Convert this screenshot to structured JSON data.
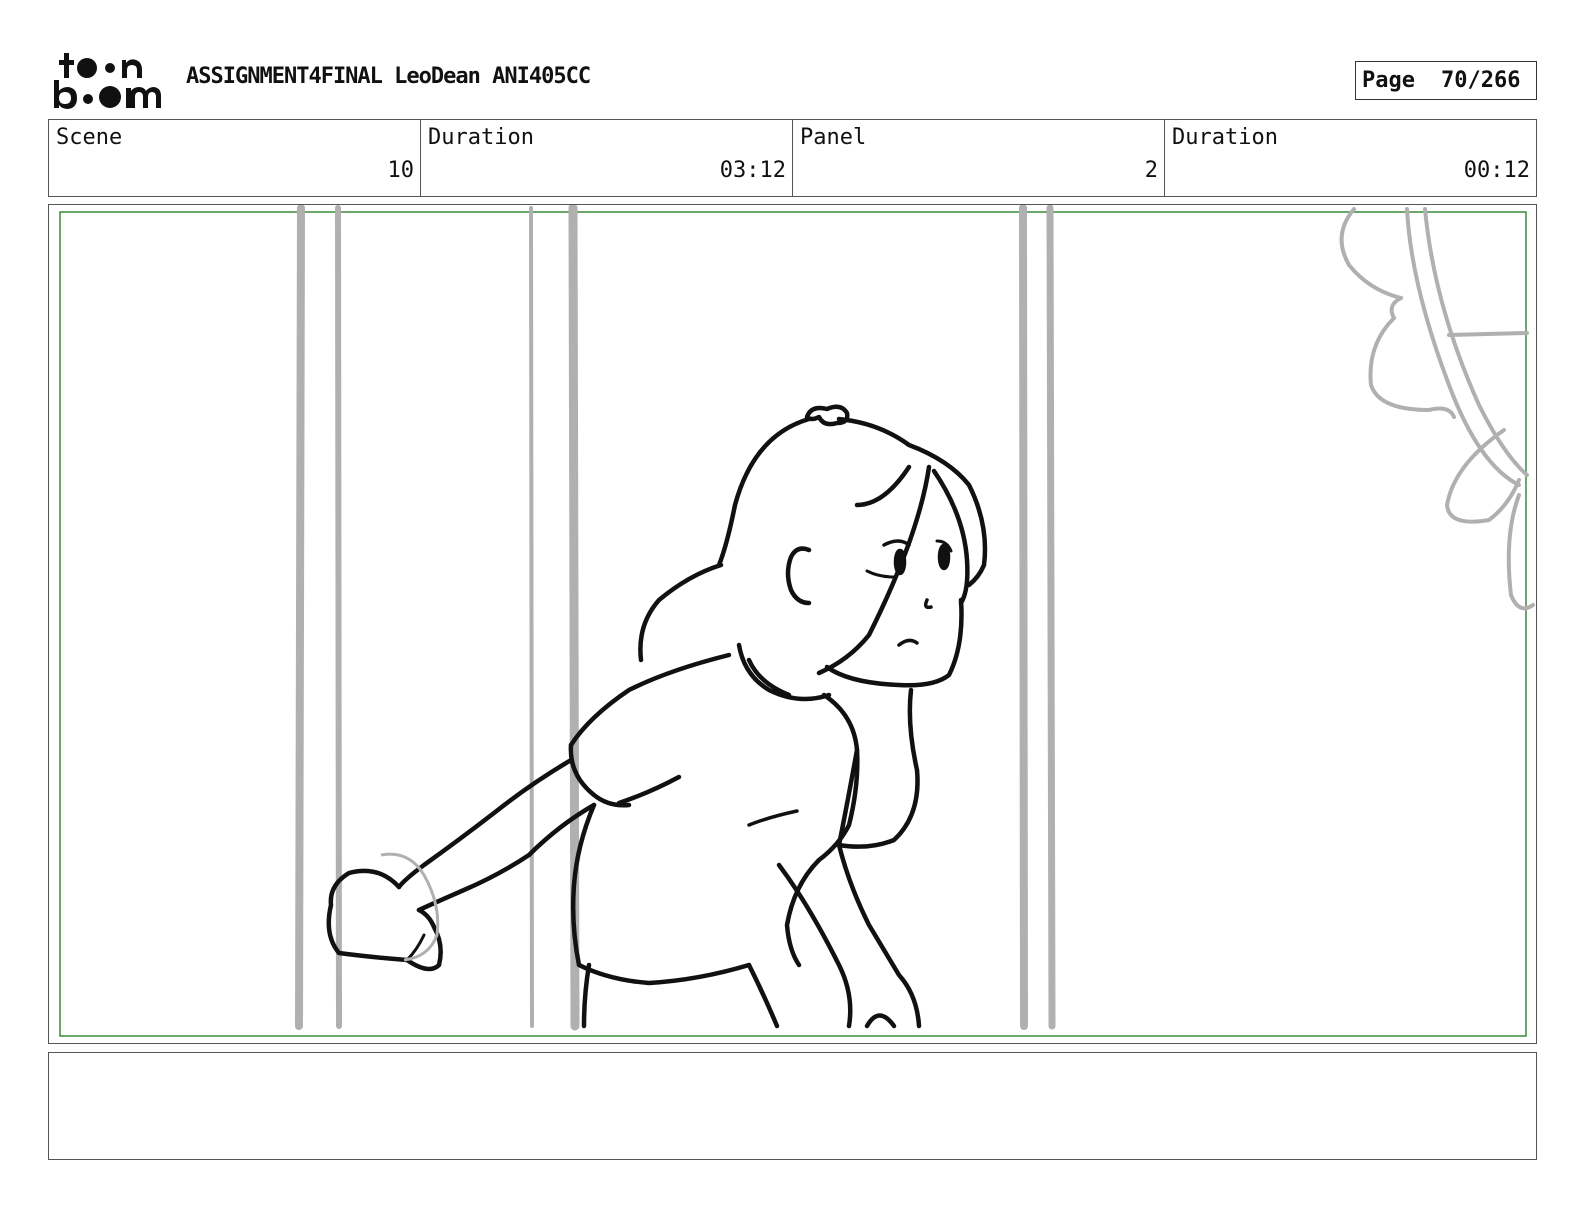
{
  "header": {
    "logo_text": "toon boom",
    "project_title": "ASSIGNMENT4FINAL LeoDean ANI405CC",
    "page_label": "Page",
    "page_value": "70/266"
  },
  "info": {
    "scene_label": "Scene",
    "scene_value": "10",
    "scene_duration_label": "Duration",
    "scene_duration_value": "03:12",
    "panel_label": "Panel",
    "panel_value": "2",
    "panel_duration_label": "Duration",
    "panel_duration_value": "00:12"
  },
  "colors": {
    "safe_frame": "#3a8a3a",
    "sketch_ink": "#111111",
    "bg_sketch": "#b0b0b0"
  }
}
